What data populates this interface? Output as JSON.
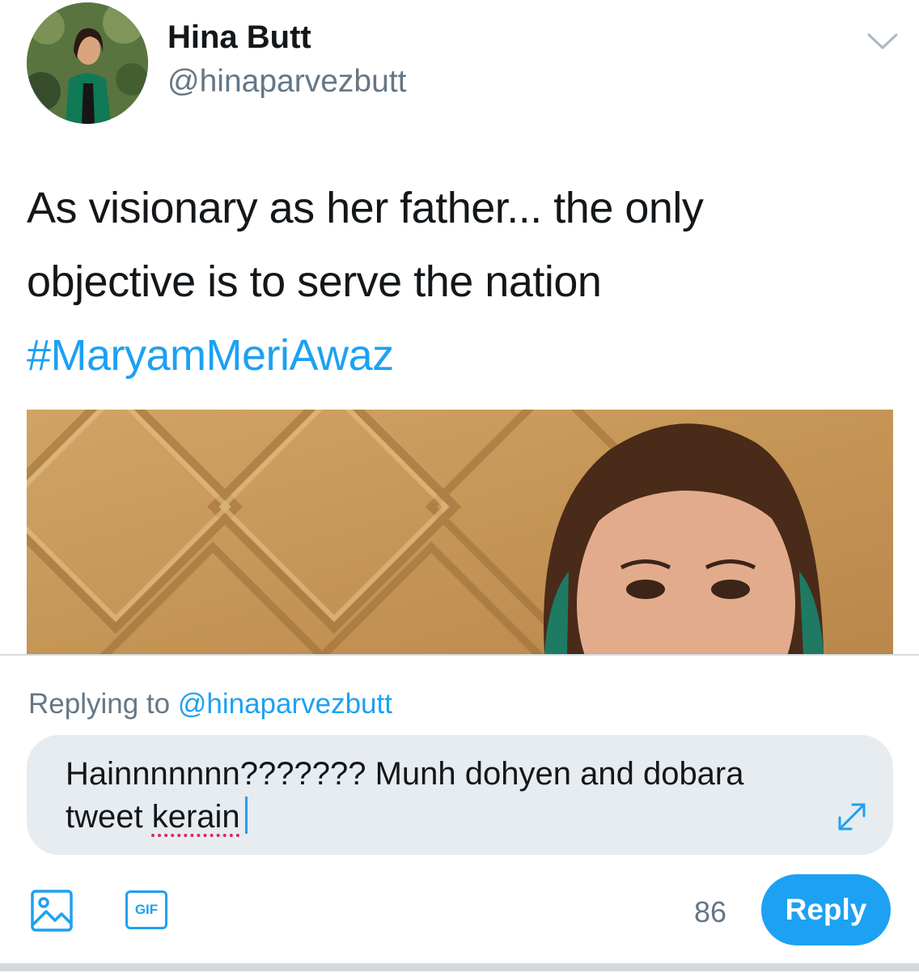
{
  "author": {
    "name": "Hina Butt",
    "handle": "@hinaparvezbutt"
  },
  "tweet": {
    "text_line1": "As visionary as her father... the only",
    "text_line2": "objective is to serve the nation",
    "hashtag": "#MaryamMeriAwaz"
  },
  "compose": {
    "replying_prefix": "Replying to",
    "replying_handle": "@hinaparvezbutt",
    "draft_line1": "Hainnnnnnn??????? Munh dohyen and dobara",
    "draft_line2_start": "tweet",
    "draft_misspelled": "kerain",
    "char_counter": "86",
    "gif_label": "GIF",
    "reply_label": "Reply"
  },
  "icons": {
    "menu": "chevron-down-icon",
    "expand": "expand-icon",
    "media": "image-icon",
    "gif": "gif-icon"
  },
  "colors": {
    "accent": "#1da1f2",
    "muted": "#657786",
    "text": "#14171a",
    "compose_bg": "#e6ecf0",
    "spell_error": "#e0245e"
  }
}
